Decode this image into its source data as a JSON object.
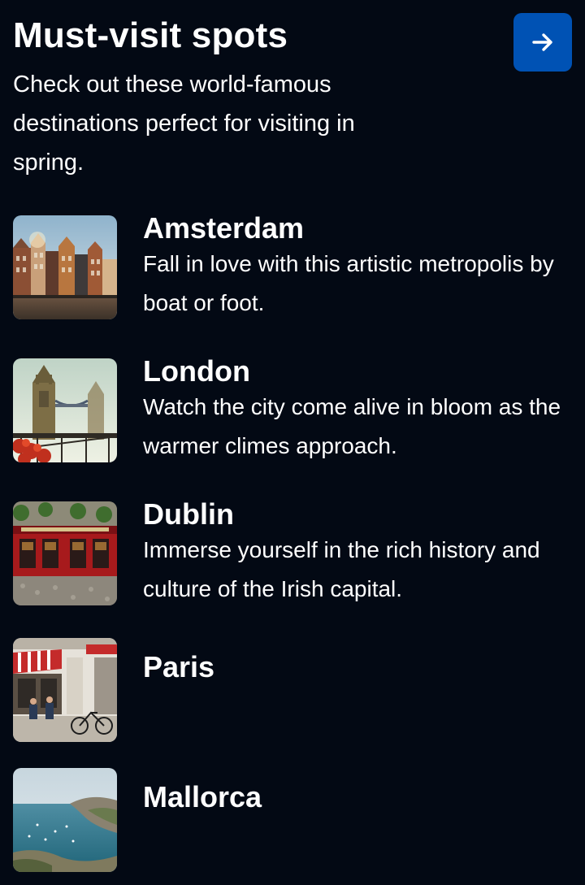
{
  "header": {
    "title": "Must-visit spots",
    "subtitle": "Check out these world-famous destinations perfect for visiting in spring.",
    "action_icon": "arrow-right-icon"
  },
  "colors": {
    "background": "#030914",
    "accent": "#0052b4",
    "text": "#ffffff"
  },
  "destinations": [
    {
      "name": "Amsterdam",
      "description": "Fall in love with this artistic metropolis by boat or foot.",
      "image": "amsterdam-canal-houses-photo"
    },
    {
      "name": "London",
      "description": "Watch the city come alive in bloom as the warmer climes approach.",
      "image": "london-tower-bridge-photo"
    },
    {
      "name": "Dublin",
      "description": "Immerse yourself in the rich history and culture of the Irish capital.",
      "image": "dublin-red-pub-photo"
    },
    {
      "name": "Paris",
      "description": "",
      "image": "paris-street-cafe-photo"
    },
    {
      "name": "Mallorca",
      "description": "",
      "image": "mallorca-coast-photo"
    }
  ]
}
